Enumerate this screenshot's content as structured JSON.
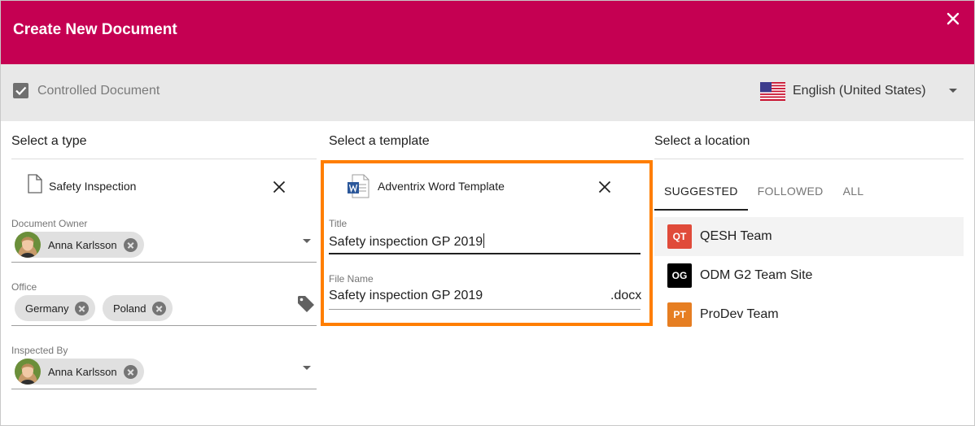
{
  "dialog": {
    "title": "Create New Document",
    "header_color": "#c50052",
    "close_icon": "close-icon"
  },
  "toolbar": {
    "controlled_label": "Controlled Document",
    "controlled_checked": true,
    "language": "English (United States)",
    "flag_icon": "us-flag-icon"
  },
  "type_column": {
    "heading": "Select a type",
    "selected_type": "Safety Inspection",
    "fields": {
      "document_owner": {
        "label": "Document Owner",
        "chips": [
          "Anna Karlsson"
        ]
      },
      "office": {
        "label": "Office",
        "chips": [
          "Germany",
          "Poland"
        ]
      },
      "inspected_by": {
        "label": "Inspected By",
        "chips": [
          "Anna Karlsson"
        ]
      }
    }
  },
  "template_column": {
    "heading": "Select a template",
    "template_name": "Adventrix Word Template",
    "highlight_color": "#ff7e00",
    "title_field": {
      "label": "Title",
      "value": "Safety inspection GP 2019"
    },
    "filename_field": {
      "label": "File Name",
      "value": "Safety inspection GP 2019",
      "extension": ".docx"
    }
  },
  "location_column": {
    "heading": "Select a location",
    "tabs": [
      "SUGGESTED",
      "FOLLOWED",
      "ALL"
    ],
    "active_tab": "SUGGESTED",
    "sites": [
      {
        "abbr": "QT",
        "name": "QESH Team",
        "color": "#e04b3a"
      },
      {
        "abbr": "OG",
        "name": "ODM G2 Team Site",
        "color": "#000000"
      },
      {
        "abbr": "PT",
        "name": "ProDev Team",
        "color": "#e67e22"
      }
    ]
  }
}
